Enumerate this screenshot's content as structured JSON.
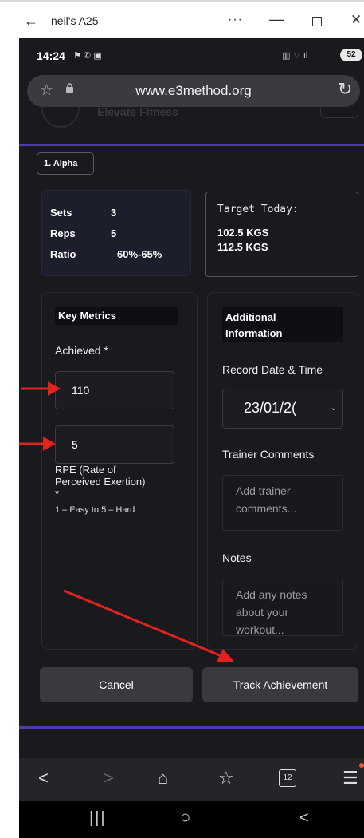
{
  "window": {
    "back": "←",
    "title": "neil's A25",
    "more": "···",
    "minimize": "—",
    "close": "✕"
  },
  "status_bar": {
    "time": "14:24",
    "left_icons": "⚑ ✆ ▣",
    "right_icons": "▥ ⌔ ıl",
    "battery": "52"
  },
  "browser": {
    "url": "www.e3method.org",
    "star": "☆",
    "lock": "🔒",
    "reload": "↻"
  },
  "site_header": {
    "brand": "Elevate Fitness"
  },
  "exercise": {
    "name": "1. Alpha"
  },
  "stats": {
    "sets_label": "Sets",
    "sets_value": "3",
    "reps_label": "Reps",
    "reps_value": "5",
    "ratio_label": "Ratio",
    "ratio_value": "60%-65%"
  },
  "target": {
    "label": "Target Today:",
    "weight_1": "102.5 KGS",
    "weight_2": "112.5 KGS"
  },
  "key_metrics": {
    "title": "Key Metrics",
    "achieved_label": "Achieved *",
    "achieved_value": "110",
    "rpe_value": "5",
    "rpe_label_line1": "RPE (Rate of",
    "rpe_label_line2": "Perceived Exertion)",
    "rpe_required": "*",
    "rpe_hint": "1 – Easy to 5 – Hard"
  },
  "additional_info": {
    "title_line1": "Additional",
    "title_line2": "Information",
    "record_label": "Record Date & Time",
    "date_value": "23/01/2(",
    "trainer_label": "Trainer Comments",
    "trainer_placeholder_1": "Add trainer",
    "trainer_placeholder_2": "comments...",
    "notes_label": "Notes",
    "notes_placeholder_1": "Add any notes",
    "notes_placeholder_2": "about your",
    "notes_placeholder_3": "workout..."
  },
  "buttons": {
    "cancel": "Cancel",
    "track": "Track Achievement"
  },
  "bottom_nav": {
    "back": "<",
    "forward": ">",
    "home": "⌂",
    "favorites": "☆",
    "tabs": "12",
    "menu": "☰"
  },
  "system_nav": {
    "recents": "|||",
    "home": "○",
    "back": "<"
  },
  "colors": {
    "background": "#1a191e",
    "accent_line": "#4b3ab0",
    "arrow": "#e0231f",
    "card": "#1c1e2c"
  }
}
